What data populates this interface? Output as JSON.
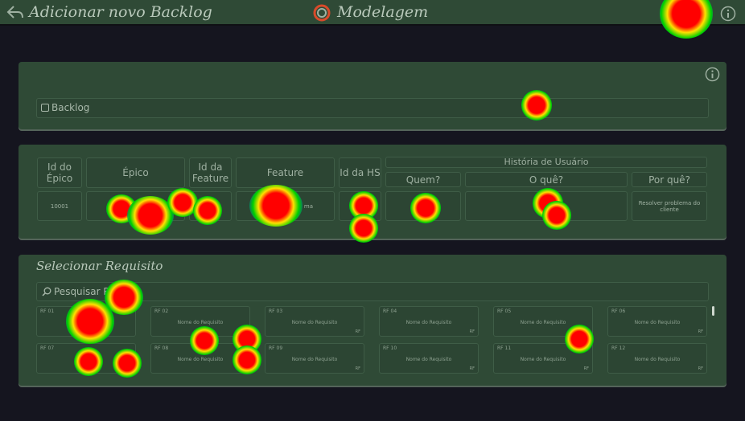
{
  "topbar": {
    "title": "Adicionar novo Backlog",
    "app_name": "Modelagem",
    "icons": [
      "back-arrow-icon",
      "app-logo-icon",
      "info-icon"
    ]
  },
  "backlog_panel": {
    "field_label": "Backlog",
    "icons": [
      "info-icon",
      "checkbox-icon"
    ]
  },
  "story_table": {
    "group_header": "História de Usuário",
    "headers": {
      "epic_id": "Id do Épico",
      "epic": "Épico",
      "feature_id": "Id da Feature",
      "feature": "Feature",
      "hs_id": "Id da HS",
      "who": "Quem?",
      "what": "O quê?",
      "why": "Por quê?"
    },
    "values": {
      "epic_id": "10001",
      "feature": "ma",
      "why": "Resolver problema do cliente"
    }
  },
  "requirements": {
    "title": "Selecionar Requisito",
    "search_placeholder": "Pesquisar R",
    "row1": [
      {
        "id": "RF 01",
        "name": "",
        "prio": ""
      },
      {
        "id": "RF 02",
        "name": "Nome do Requisito",
        "prio": "RF"
      },
      {
        "id": "RF 03",
        "name": "Nome do Requisito",
        "prio": "RF"
      },
      {
        "id": "RF 04",
        "name": "Nome do Requisito",
        "prio": "RF"
      },
      {
        "id": "RF 05",
        "name": "Nome do Requisito",
        "prio": "RF"
      },
      {
        "id": "RF 06",
        "name": "Nome do Requisito",
        "prio": "RF"
      }
    ],
    "row2": [
      {
        "id": "RF 07",
        "name": "No",
        "prio": ""
      },
      {
        "id": "RF 08",
        "name": "Nome do Requisito",
        "prio": "RF"
      },
      {
        "id": "RF 09",
        "name": "Nome do Requisito",
        "prio": "RF"
      },
      {
        "id": "RF 10",
        "name": "Nome do Requisito",
        "prio": "RF"
      },
      {
        "id": "RF 11",
        "name": "Nome do Requisito",
        "prio": "RF"
      },
      {
        "id": "RF 12",
        "name": "Nome do Requisito",
        "prio": "RF"
      }
    ]
  },
  "colors": {
    "background": "#15151f",
    "panel": "#2f4a36",
    "heat_core": "#ff0000",
    "heat_mid": "#ffe000",
    "heat_outer": "#00d000"
  }
}
